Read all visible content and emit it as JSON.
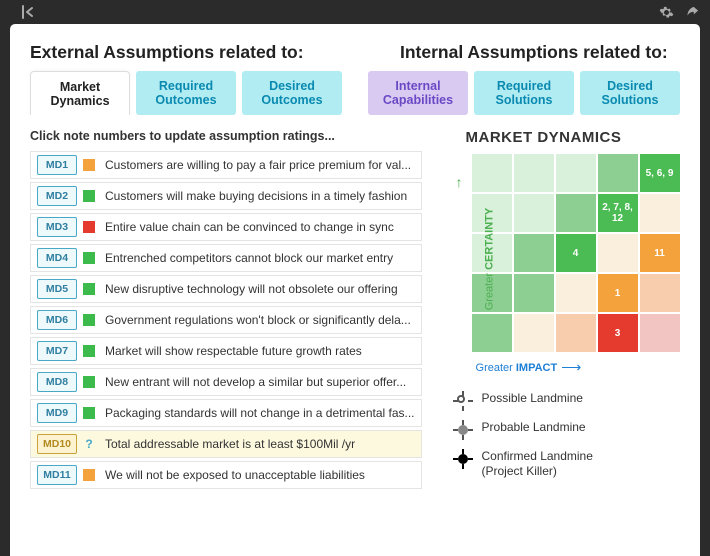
{
  "headings": {
    "external": "External Assumptions related to:",
    "internal": "Internal Assumptions related to:"
  },
  "tabs": {
    "external": [
      {
        "label": "Market Dynamics",
        "active": true
      },
      {
        "label": "Required Outcomes",
        "active": false
      },
      {
        "label": "Desired Outcomes",
        "active": false
      }
    ],
    "internal": [
      {
        "label": "Internal Capabilities",
        "style": "violet"
      },
      {
        "label": "Required Solutions",
        "style": "cyan"
      },
      {
        "label": "Desired Solutions",
        "style": "cyan"
      }
    ]
  },
  "instruction": "Click note numbers to update assumption ratings...",
  "assumptions": [
    {
      "code": "MD1",
      "status": "orange",
      "text": "Customers are willing to pay a fair price premium for val..."
    },
    {
      "code": "MD2",
      "status": "green",
      "text": "Customers will make buying decisions in a timely fashion"
    },
    {
      "code": "MD3",
      "status": "red",
      "text": "Entire value chain can be convinced to change in sync"
    },
    {
      "code": "MD4",
      "status": "green",
      "text": "Entrenched competitors cannot block our market entry"
    },
    {
      "code": "MD5",
      "status": "green",
      "text": "New disruptive technology will not obsolete our offering"
    },
    {
      "code": "MD6",
      "status": "green",
      "text": "Government regulations won't block or significantly dela..."
    },
    {
      "code": "MD7",
      "status": "green",
      "text": "Market will show respectable future growth rates"
    },
    {
      "code": "MD8",
      "status": "green",
      "text": "New entrant will not develop a similar but superior offer..."
    },
    {
      "code": "MD9",
      "status": "green",
      "text": "Packaging standards will not change in a detrimental fas..."
    },
    {
      "code": "MD10",
      "status": "question",
      "text": "Total addressable market is at least $100Mil /yr",
      "highlight": true
    },
    {
      "code": "MD11",
      "status": "orange",
      "text": "We will not be exposed to unacceptable liabilities"
    }
  ],
  "chart": {
    "title": "MARKET DYNAMICS",
    "ylabel": {
      "pre": "Greater ",
      "bold": "CERTAINTY"
    },
    "xlabel": {
      "pre": "Greater ",
      "bold": "IMPACT"
    },
    "cells": {
      "r0c4": "5, 6, 9",
      "r1c3": "2, 7, 8, 12",
      "r2c2": "4",
      "r2c4": "11",
      "r3c3": "1",
      "r4c3": "3"
    }
  },
  "legend": [
    {
      "kind": "poss",
      "label": "Possible Landmine"
    },
    {
      "kind": "prob",
      "label": "Probable Landmine"
    },
    {
      "kind": "conf",
      "label": "Confirmed Landmine",
      "sub": "(Project Killer)"
    }
  ],
  "chart_data": {
    "type": "heatmap",
    "title": "MARKET DYNAMICS",
    "xlabel": "Greater IMPACT",
    "ylabel": "Greater CERTAINTY",
    "grid_size": [
      5,
      5
    ],
    "placements_row_col": {
      "5": [
        0,
        4
      ],
      "6": [
        0,
        4
      ],
      "9": [
        0,
        4
      ],
      "2": [
        1,
        3
      ],
      "7": [
        1,
        3
      ],
      "8": [
        1,
        3
      ],
      "12": [
        1,
        3
      ],
      "4": [
        2,
        2
      ],
      "11": [
        2,
        4
      ],
      "1": [
        3,
        3
      ],
      "3": [
        4,
        3
      ]
    },
    "cell_status_row_major": [
      [
        "lg",
        "lg",
        "lg",
        "sg",
        "mg"
      ],
      [
        "lg",
        "lg",
        "sg",
        "mg",
        "cream"
      ],
      [
        "lg",
        "sg",
        "mg",
        "cream",
        "or"
      ],
      [
        "sg",
        "sg",
        "cream",
        "or",
        "lor"
      ],
      [
        "sg",
        "cream",
        "lor",
        "rd",
        "lr"
      ]
    ]
  }
}
